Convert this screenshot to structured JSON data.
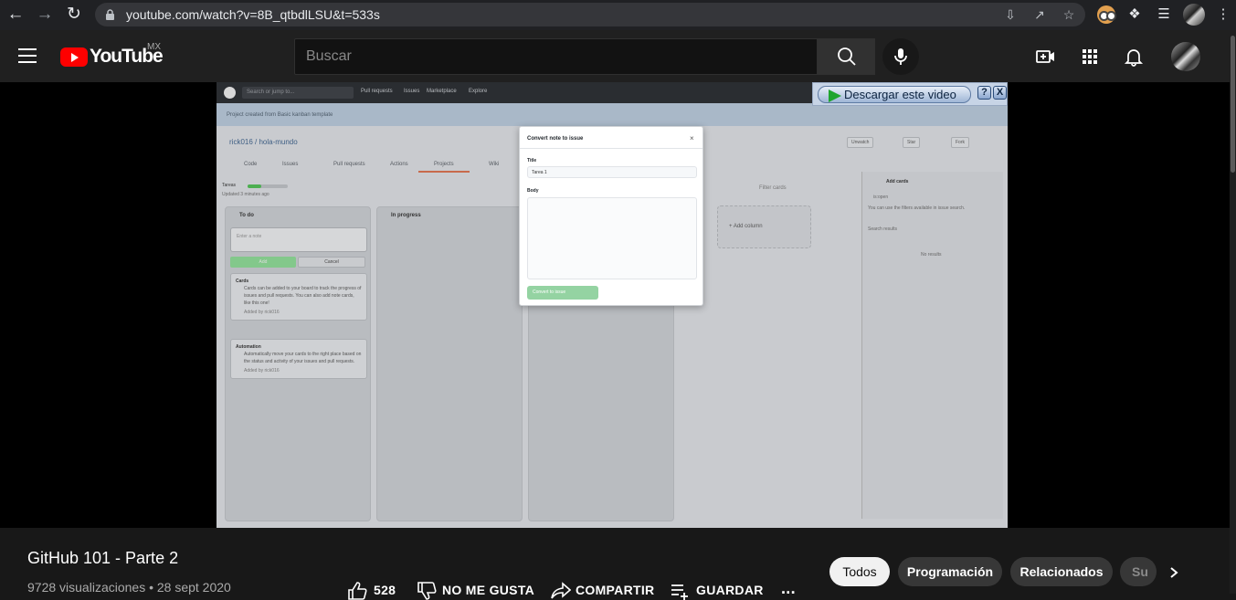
{
  "browser": {
    "url": "youtube.com/watch?v=8B_qtbdlLSU&t=533s"
  },
  "header": {
    "logo_text": "YouTube",
    "country": "MX",
    "search_placeholder": "Buscar"
  },
  "player": {
    "github": {
      "search_placeholder": "Search or jump to...",
      "nav": [
        "Pull requests",
        "Issues",
        "Marketplace",
        "Explore"
      ],
      "banner": "Project created from Basic kanban template",
      "repo": "rick016 / hola-mundo",
      "tabs": [
        "Code",
        "Issues",
        "Pull requests",
        "Actions",
        "Projects",
        "Wiki"
      ],
      "repo_buttons": [
        "Unwatch",
        "Star",
        "Fork"
      ],
      "project_name": "Tareas",
      "project_updated": "Updated 3 minutes ago",
      "progress_fraction": 0.35,
      "filter_placeholder": "Filter cards",
      "columns": [
        "To do",
        "In progress"
      ],
      "note_placeholder": "Enter a note",
      "add_label": "Add",
      "cancel_label": "Cancel",
      "cards": [
        {
          "title": "Cards",
          "body": "Cards can be added to your board to track the progress of issues and pull requests. You can also add note cards, like this one!",
          "added_by": "Added by rick016"
        },
        {
          "title": "Automation",
          "body": "Automatically move your cards to the right place based on the status and activity of your issues and pull requests.",
          "added_by": "Added by rick016"
        }
      ],
      "add_column": "+ Add column",
      "side_title": "Add cards",
      "side_search": "is:open",
      "side_hint": "You can use the filters available in issue search.",
      "side_results": "Search results",
      "side_empty": "No results",
      "modal": {
        "title": "Convert note to issue",
        "title_label": "Title",
        "title_value": "Tarea 1",
        "body_label": "Body",
        "submit": "Convert to issue"
      }
    },
    "download_label": "Descargar este video",
    "download_help": "?",
    "download_close": "X"
  },
  "video": {
    "title": "GitHub 101 - Parte 2",
    "meta": "9728 visualizaciones • 28 sept 2020",
    "likes": "528",
    "dislike_label": "NO ME GUSTA",
    "share_label": "COMPARTIR",
    "save_label": "GUARDAR",
    "more_label": "..."
  },
  "chips": [
    "Todos",
    "Programación",
    "Relacionados",
    "Su"
  ],
  "colors": {
    "youtube_red": "#ff0000",
    "header_bg": "#202020",
    "page_bg": "#181818"
  }
}
